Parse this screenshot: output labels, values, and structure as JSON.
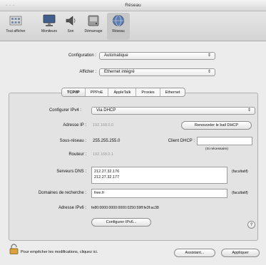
{
  "window": {
    "title": "Réseau",
    "traffic_lights": "◦ ◦ ◦"
  },
  "toolbar": {
    "items": [
      {
        "label": "Tout afficher",
        "icon": "show-all-icon"
      },
      {
        "label": "Moniteurs",
        "icon": "display-icon"
      },
      {
        "label": "Son",
        "icon": "sound-icon"
      },
      {
        "label": "Démarrage",
        "icon": "startup-disk-icon"
      },
      {
        "label": "Réseau",
        "icon": "network-icon"
      }
    ]
  },
  "config": {
    "configuration_label": "Configuration :",
    "configuration_value": "Automatique",
    "afficher_label": "Afficher :",
    "afficher_value": "Ethernet intégré"
  },
  "tabs": [
    "TCP/IP",
    "PPPoE",
    "AppleTalk",
    "Proxies",
    "Ethernet"
  ],
  "tcpip": {
    "configurer_label": "Configurer IPv4 :",
    "configurer_value": "Via DHCP",
    "adresse_ip_label": "Adresse IP :",
    "adresse_ip_value": "192.168.0.0",
    "renew_button": "Renouveler le bail DHCP",
    "sous_reseau_label": "Sous-réseau :",
    "sous_reseau_value": "255.255.255.0",
    "client_dhcp_label": "Client DHCP :",
    "client_dhcp_value": "",
    "client_dhcp_hint": "(Si nécessaire)",
    "routeur_label": "Routeur :",
    "routeur_value": "192.168.0.1",
    "dns_label": "Serveurs DNS :",
    "dns_values": [
      "212.27.32.176",
      "212.27.32.177"
    ],
    "dns_optional": "(facultatif)",
    "domaines_label": "Domaines de recherche :",
    "domaines_value": "free.fr",
    "domaines_optional": "(facultatif)",
    "ipv6_label": "Adresse IPv6 :",
    "ipv6_value": "fe80:0000:0000:0000:0250:59ff:fe3f:ac38",
    "ipv6_button": "Configurer IPv6..."
  },
  "footer": {
    "lock_text": "Pour empêcher les modifications, cliquez ici.",
    "assist_button": "Assistant...",
    "apply_button": "Appliquer"
  },
  "help_symbol": "?"
}
